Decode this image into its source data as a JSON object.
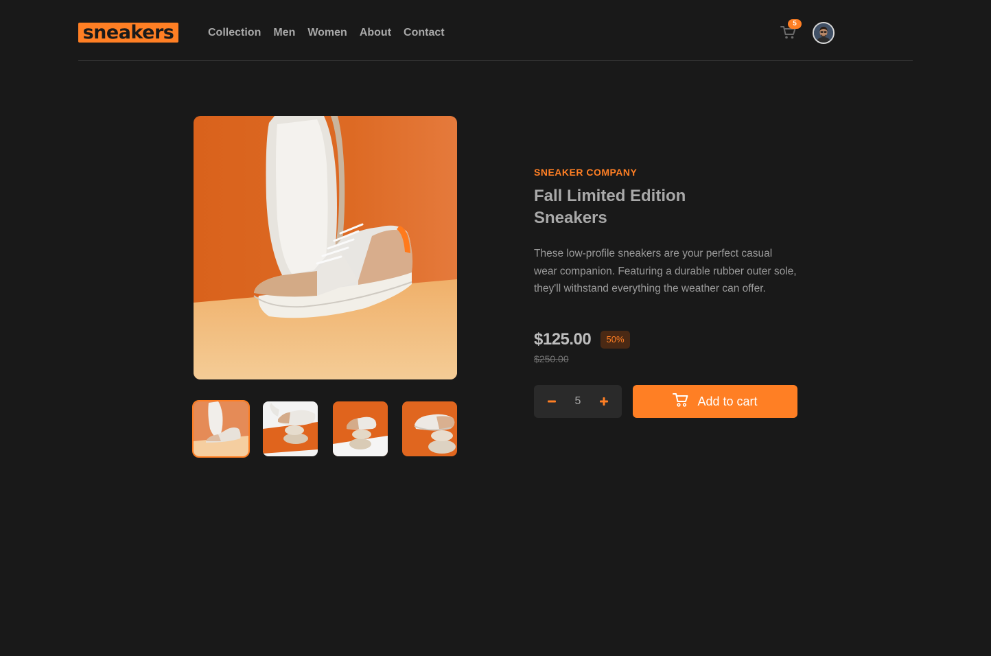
{
  "header": {
    "logo_text": "sneakers",
    "nav": [
      "Collection",
      "Men",
      "Women",
      "About",
      "Contact"
    ],
    "cart_count": "5"
  },
  "product": {
    "company": "SNEAKER COMPANY",
    "title": "Fall Limited Edition Sneakers",
    "description": "These low-profile sneakers are your perfect casual wear companion. Featuring a durable rubber outer sole, they'll withstand everything the weather can offer.",
    "price": "$125.00",
    "discount": "50%",
    "original_price": "$250.00",
    "quantity": "5",
    "add_to_cart_label": "Add to cart"
  },
  "gallery": {
    "active_thumbnail": 1,
    "thumbnail_count": 4
  },
  "colors": {
    "accent": "#ff7f24",
    "background": "#191919"
  }
}
